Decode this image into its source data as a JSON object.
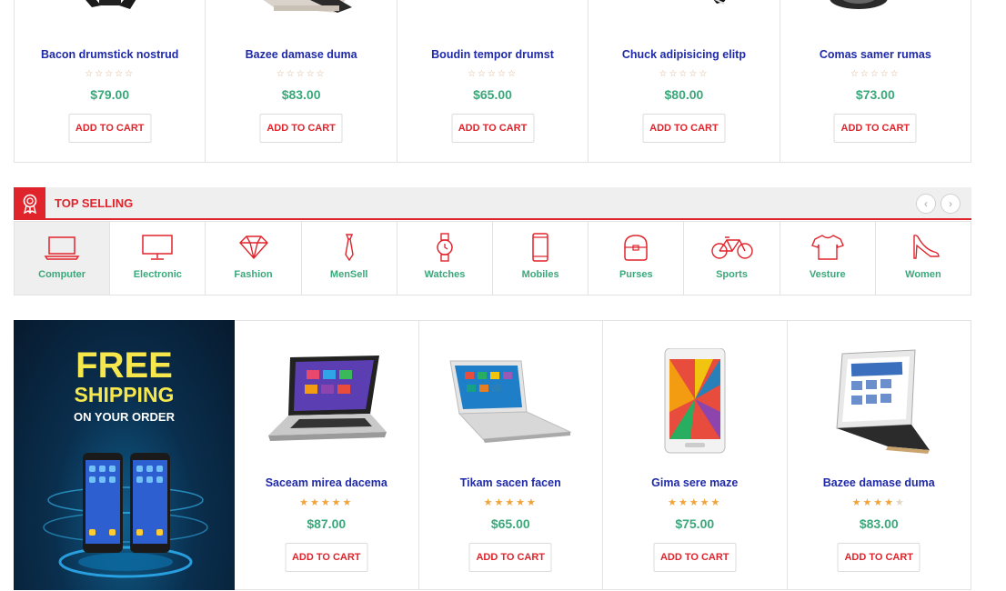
{
  "top_products": [
    {
      "name": "Bacon drumstick nostrud",
      "rating": 0,
      "price": "$79.00",
      "button": "ADD TO CART"
    },
    {
      "name": "Bazee damase duma",
      "rating": 0,
      "price": "$83.00",
      "button": "ADD TO CART"
    },
    {
      "name": "Boudin tempor drumst",
      "rating": 0,
      "price": "$65.00",
      "button": "ADD TO CART"
    },
    {
      "name": "Chuck adipisicing elitp",
      "rating": 0,
      "price": "$80.00",
      "button": "ADD TO CART"
    },
    {
      "name": "Comas samer rumas",
      "rating": 0,
      "price": "$73.00",
      "button": "ADD TO CART"
    }
  ],
  "top_selling": {
    "title": "TOP SELLING",
    "prev_arrow": "‹",
    "next_arrow": "›",
    "categories": [
      {
        "label": "Computer",
        "icon": "laptop-icon",
        "active": true
      },
      {
        "label": "Electronic",
        "icon": "monitor-icon",
        "active": false
      },
      {
        "label": "Fashion",
        "icon": "diamond-icon",
        "active": false
      },
      {
        "label": "MenSell",
        "icon": "tie-icon",
        "active": false
      },
      {
        "label": "Watches",
        "icon": "watch-icon",
        "active": false
      },
      {
        "label": "Mobiles",
        "icon": "phone-icon",
        "active": false
      },
      {
        "label": "Purses",
        "icon": "purse-icon",
        "active": false
      },
      {
        "label": "Sports",
        "icon": "bicycle-icon",
        "active": false
      },
      {
        "label": "Vesture",
        "icon": "tshirt-icon",
        "active": false
      },
      {
        "label": "Women",
        "icon": "high-heel-icon",
        "active": false
      }
    ]
  },
  "promo": {
    "line1": "FREE",
    "line2": "SHIPPING",
    "line3": "ON YOUR ORDER"
  },
  "bottom_products": [
    {
      "name": "Saceam mirea dacema",
      "rating": 5,
      "price": "$87.00",
      "button": "ADD TO CART",
      "image": "laptop"
    },
    {
      "name": "Tikam sacen facen",
      "rating": 5,
      "price": "$65.00",
      "button": "ADD TO CART",
      "image": "laptop-silver"
    },
    {
      "name": "Gima sere maze",
      "rating": 5,
      "price": "$75.00",
      "button": "ADD TO CART",
      "image": "tablet"
    },
    {
      "name": "Bazee damase duma",
      "rating": 4.5,
      "price": "$83.00",
      "button": "ADD TO CART",
      "image": "tablet-case"
    }
  ],
  "colors": {
    "accent_red": "#e0242c",
    "name_blue": "#1f2aa8",
    "price_green": "#3aa87a",
    "star_orange": "#f0a33a",
    "promo_yellow": "#f6e84c"
  }
}
